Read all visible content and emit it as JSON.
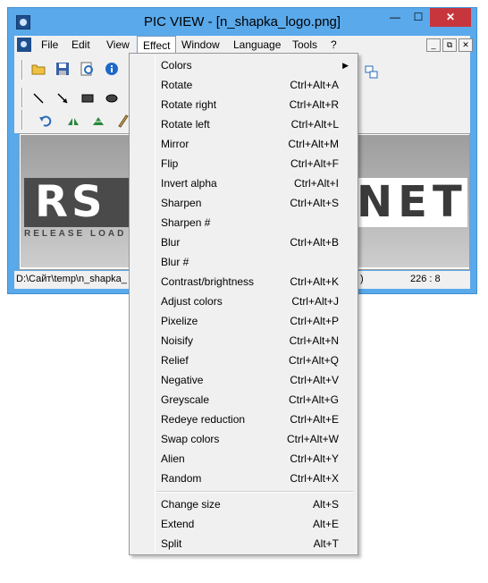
{
  "window": {
    "title": "PIC VIEW  - [n_shapka_logo.png]",
    "min_glyph": "—",
    "max_glyph": "☐",
    "close_glyph": "✕"
  },
  "menubar": {
    "items": [
      {
        "label": "File"
      },
      {
        "label": "Edit"
      },
      {
        "label": "View"
      },
      {
        "label": "Effect"
      },
      {
        "label": "Window"
      },
      {
        "label": "Language"
      },
      {
        "label": "Tools"
      },
      {
        "label": "?"
      }
    ],
    "mdi": {
      "min": "_",
      "restore": "⧉",
      "close": "✕"
    }
  },
  "image": {
    "logo_left": "RS",
    "logo_right": "NET",
    "logo_sub": "RELEASE LOAD"
  },
  "status": {
    "path": "D:\\Сайт\\temp\\n_shapka_",
    "fragment": ")",
    "coords": "226 : 8"
  },
  "effect_menu": {
    "arrow": "▶",
    "groups": [
      [
        {
          "label": "Colors",
          "shortcut": "",
          "submenu": true
        },
        {
          "label": "Rotate",
          "shortcut": "Ctrl+Alt+A"
        },
        {
          "label": "Rotate right",
          "shortcut": "Ctrl+Alt+R"
        },
        {
          "label": "Rotate left",
          "shortcut": "Ctrl+Alt+L"
        },
        {
          "label": "Mirror",
          "shortcut": "Ctrl+Alt+M"
        },
        {
          "label": "Flip",
          "shortcut": "Ctrl+Alt+F"
        },
        {
          "label": "Invert alpha",
          "shortcut": "Ctrl+Alt+I"
        },
        {
          "label": "Sharpen",
          "shortcut": "Ctrl+Alt+S"
        },
        {
          "label": "Sharpen #",
          "shortcut": ""
        },
        {
          "label": "Blur",
          "shortcut": "Ctrl+Alt+B"
        },
        {
          "label": "Blur #",
          "shortcut": ""
        },
        {
          "label": "Contrast/brightness",
          "shortcut": "Ctrl+Alt+K"
        },
        {
          "label": "Adjust colors",
          "shortcut": "Ctrl+Alt+J"
        },
        {
          "label": "Pixelize",
          "shortcut": "Ctrl+Alt+P"
        },
        {
          "label": "Noisify",
          "shortcut": "Ctrl+Alt+N"
        },
        {
          "label": "Relief",
          "shortcut": "Ctrl+Alt+Q"
        },
        {
          "label": "Negative",
          "shortcut": "Ctrl+Alt+V"
        },
        {
          "label": "Greyscale",
          "shortcut": "Ctrl+Alt+G"
        },
        {
          "label": "Redeye reduction",
          "shortcut": "Ctrl+Alt+E"
        },
        {
          "label": "Swap colors",
          "shortcut": "Ctrl+Alt+W"
        },
        {
          "label": "Alien",
          "shortcut": "Ctrl+Alt+Y"
        },
        {
          "label": "Random",
          "shortcut": "Ctrl+Alt+X"
        }
      ],
      [
        {
          "label": "Change size",
          "shortcut": "Alt+S"
        },
        {
          "label": "Extend",
          "shortcut": "Alt+E"
        },
        {
          "label": "Split",
          "shortcut": "Alt+T"
        }
      ]
    ]
  },
  "toolbar": {
    "icons": [
      "open-folder-icon",
      "save-icon",
      "preview-icon",
      "info-icon",
      "line-icon",
      "arrow-icon",
      "rectangle-icon",
      "ellipse-icon",
      "undo-icon",
      "flip-horizontal-icon",
      "flip-mirror-icon",
      "pencil-icon"
    ]
  }
}
